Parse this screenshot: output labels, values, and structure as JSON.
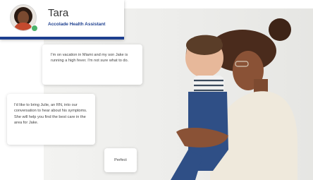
{
  "agent": {
    "name": "Tara",
    "role": "Accolade Health Assistant",
    "status_color": "#4cb26a",
    "accent_color": "#1d3f8f"
  },
  "messages": [
    {
      "from": "member",
      "text": "I'm on vacation in Miami and my son Jake is running a high fever. I'm not sure what to do."
    },
    {
      "from": "assistant",
      "text": "I'd like to bring Julie, an RN, into our conversation to hear about his symptoms. She will help you find the best care in the area for Jake."
    },
    {
      "from": "member",
      "text": "Perfect"
    }
  ]
}
